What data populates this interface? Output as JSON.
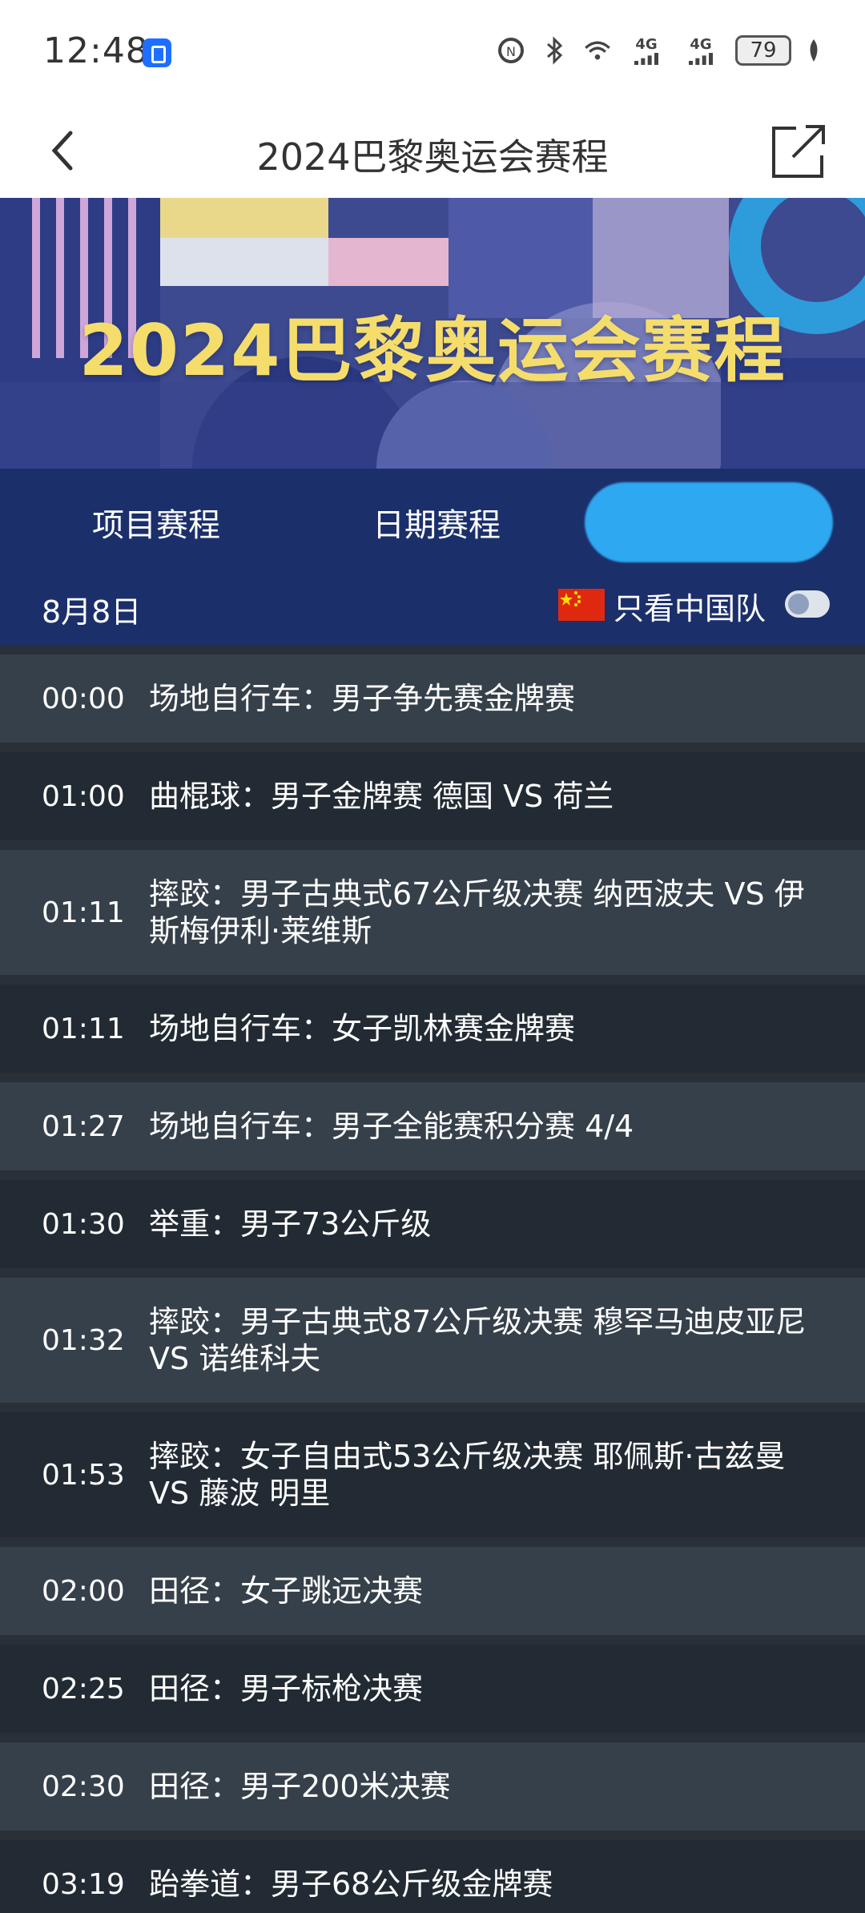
{
  "status_bar": {
    "time": "12:48",
    "battery": "79",
    "network_1": "4G",
    "network_2": "4G"
  },
  "nav": {
    "title": "2024巴黎奥运会赛程"
  },
  "banner": {
    "title": "2024巴黎奥运会赛程"
  },
  "tabs": [
    {
      "label": "项目赛程",
      "active": false
    },
    {
      "label": "日期赛程",
      "active": false
    },
    {
      "label": "",
      "active": true
    }
  ],
  "date": "8月8日",
  "filter": {
    "label": "只看中国队",
    "enabled": false
  },
  "schedule": [
    {
      "time": "00:00",
      "event": "场地自行车：男子争先赛金牌赛"
    },
    {
      "time": "01:00",
      "event": "曲棍球：男子金牌赛 德国 VS 荷兰"
    },
    {
      "time": "01:11",
      "event": "摔跤：男子古典式67公斤级决赛 纳西波夫 VS 伊斯梅伊利·莱维斯"
    },
    {
      "time": "01:11",
      "event": "场地自行车：女子凯林赛金牌赛"
    },
    {
      "time": "01:27",
      "event": "场地自行车：男子全能赛积分赛 4/4"
    },
    {
      "time": "01:30",
      "event": "举重：男子73公斤级"
    },
    {
      "time": "01:32",
      "event": "摔跤：男子古典式87公斤级决赛 穆罕马迪皮亚尼 VS 诺维科夫"
    },
    {
      "time": "01:53",
      "event": "摔跤：女子自由式53公斤级决赛 耶佩斯·古兹曼 VS 藤波 明里"
    },
    {
      "time": "02:00",
      "event": "田径：女子跳远决赛"
    },
    {
      "time": "02:25",
      "event": "田径：男子标枪决赛"
    },
    {
      "time": "02:30",
      "event": "田径：男子200米决赛"
    },
    {
      "time": "03:19",
      "event": "跆拳道：男子68公斤级金牌赛"
    }
  ]
}
